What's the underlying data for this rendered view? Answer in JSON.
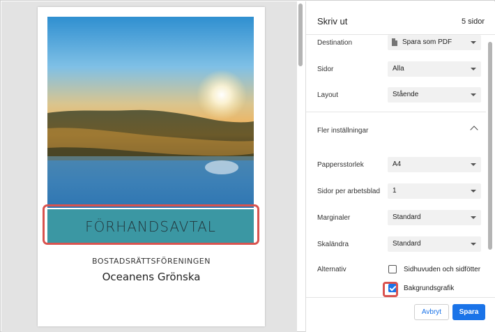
{
  "preview": {
    "banner_title": "FÖRHANDSAVTAL",
    "subtitle": "BOSTADSRÄTTSFÖRENINGEN",
    "association_name": "Oceanens Grönska"
  },
  "print_dialog": {
    "title": "Skriv ut",
    "page_count": "5 sidor",
    "destination": {
      "label": "Destination",
      "value": "Spara som PDF",
      "icon": "document-icon"
    },
    "pages": {
      "label": "Sidor",
      "value": "Alla"
    },
    "layout": {
      "label": "Layout",
      "value": "Stående"
    },
    "more_settings": {
      "label": "Fler inställningar",
      "icon": "chevron-up-icon"
    },
    "paper_size": {
      "label": "Pappersstorlek",
      "value": "A4"
    },
    "pages_per_sheet": {
      "label": "Sidor per arbetsblad",
      "value": "1"
    },
    "margins": {
      "label": "Marginaler",
      "value": "Standard"
    },
    "scale": {
      "label": "Skaländra",
      "value": "Standard"
    },
    "options": {
      "label": "Alternativ",
      "headers_footers": {
        "label": "Sidhuvuden och sidfötter",
        "checked": false
      },
      "background_graphics": {
        "label": "Bakgrundsgrafik",
        "checked": true
      }
    },
    "cancel_button": "Avbryt",
    "save_button": "Spara"
  },
  "colors": {
    "accent": "#1a73e8",
    "banner": "#3b97a3",
    "highlight": "#d9534f"
  }
}
